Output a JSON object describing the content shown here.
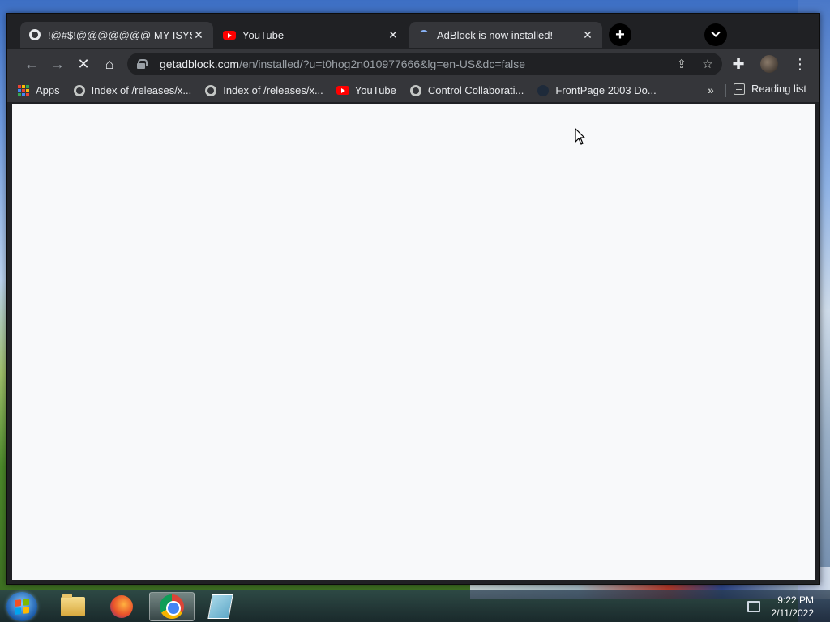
{
  "browser": {
    "tabs": [
      {
        "title": "!@#$!@@@@@@@ MY ISYS PF",
        "favicon": "globe-icon",
        "active": false
      },
      {
        "title": "YouTube",
        "favicon": "youtube-icon",
        "active": false
      },
      {
        "title": "AdBlock is now installed!",
        "favicon": "loading-spinner-icon",
        "active": true
      }
    ],
    "tab_close_glyph": "✕",
    "new_tab_glyph": "+",
    "url": {
      "host": "getadblock.com",
      "path": "/en/installed/?u=t0hog2n010977666&lg=en-US&dc=false"
    },
    "toolbar_glyphs": {
      "back": "←",
      "forward": "→",
      "stop": "✕",
      "home": "⌂",
      "share": "⇪",
      "star": "☆",
      "extensions": "✚",
      "menu": "⋮"
    },
    "bookmarks": [
      {
        "label": "Apps",
        "icon": "apps-grid-icon"
      },
      {
        "label": "Index of /releases/x...",
        "icon": "globe-icon"
      },
      {
        "label": "Index of /releases/x...",
        "icon": "globe-icon"
      },
      {
        "label": "YouTube",
        "icon": "youtube-icon"
      },
      {
        "label": "Control Collaborati...",
        "icon": "globe-icon"
      },
      {
        "label": "FrontPage 2003 Do...",
        "icon": "frontpage-icon"
      }
    ],
    "bookmarks_overflow": "»",
    "reading_list": "Reading list",
    "window_controls": {
      "minimize": "—",
      "maximize": "☐",
      "close": "✕"
    }
  },
  "taskbar": {
    "apps": [
      {
        "name": "Windows Explorer",
        "icon": "folder-icon",
        "active": false
      },
      {
        "name": "Firefox",
        "icon": "firefox-icon",
        "active": false
      },
      {
        "name": "Google Chrome",
        "icon": "chrome-icon",
        "active": true
      },
      {
        "name": "Notepad",
        "icon": "notepad-icon",
        "active": false
      }
    ],
    "clock": {
      "time": "9:22 PM",
      "date": "2/11/2022"
    }
  },
  "colors": {
    "chrome_dark": "#202124",
    "chrome_toolbar": "#35363a",
    "content_bg": "#f8f9fa",
    "youtube_red": "#ff0000"
  }
}
